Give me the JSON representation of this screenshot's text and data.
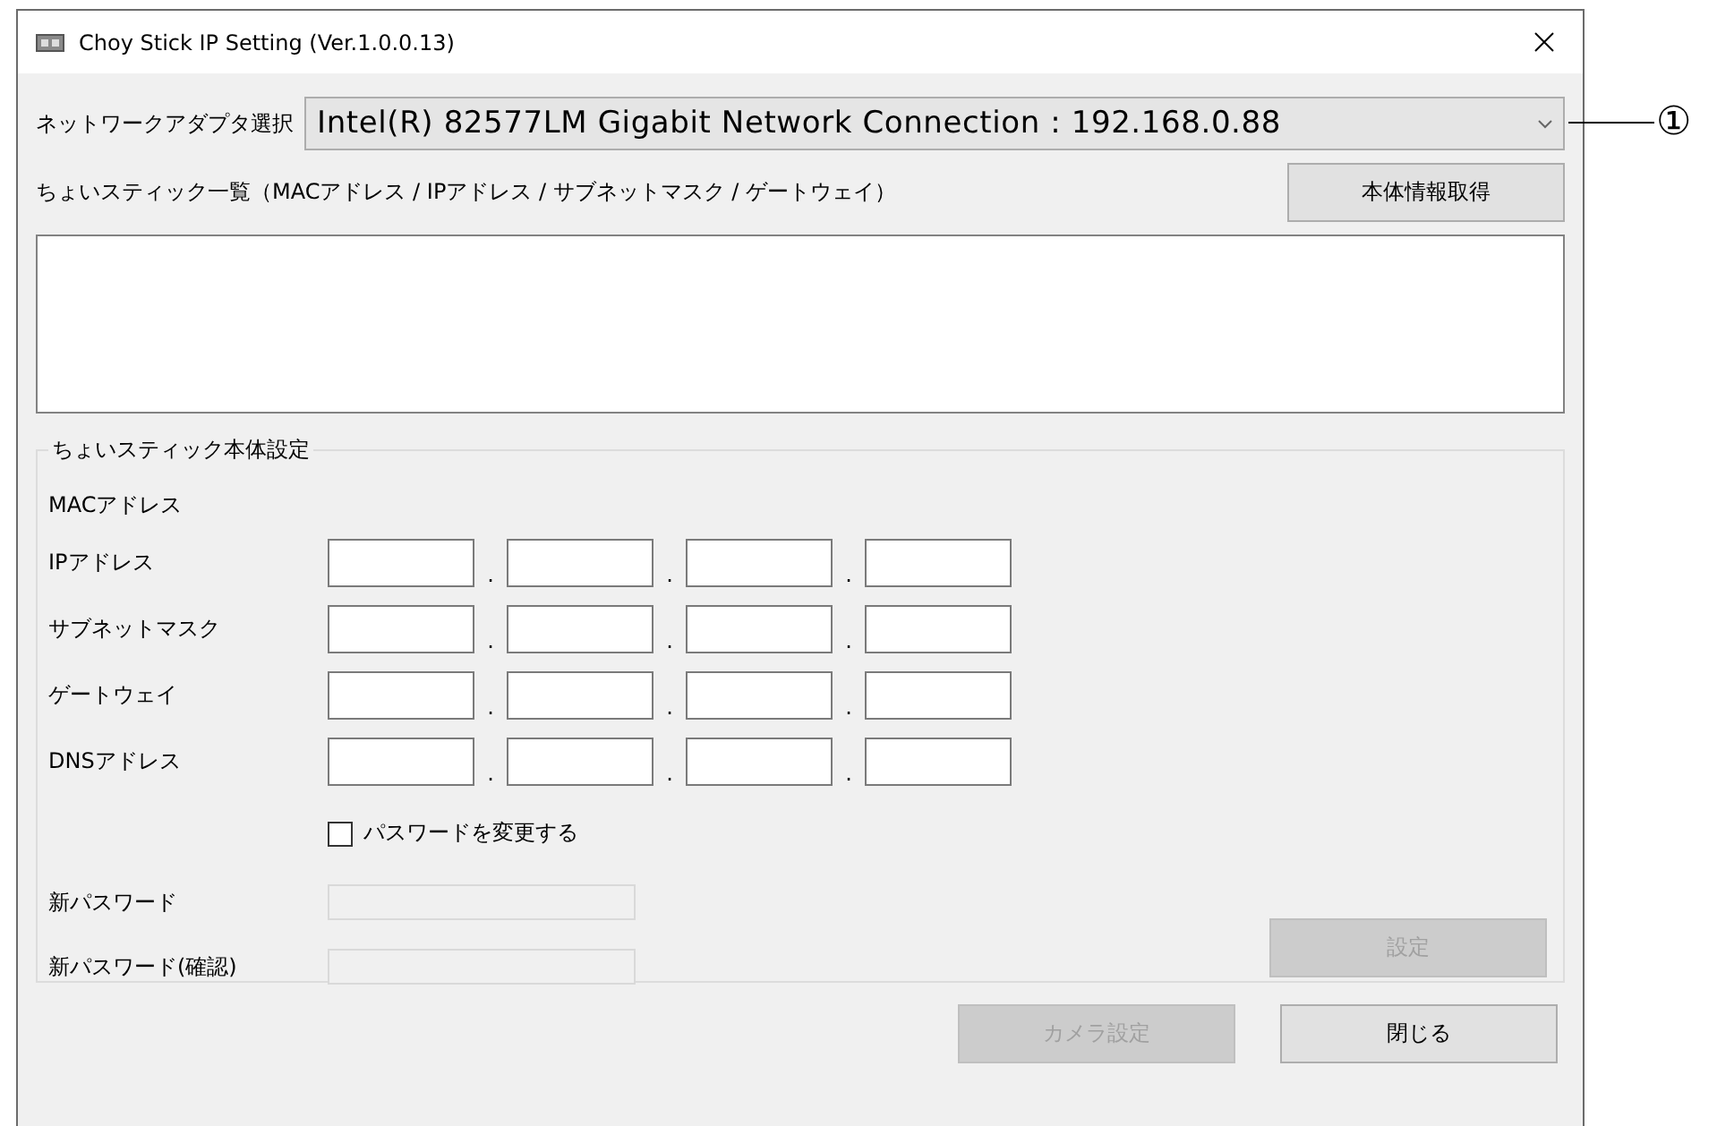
{
  "window": {
    "title": "Choy Stick IP Setting (Ver.1.0.0.13)"
  },
  "adapter": {
    "label": "ネットワークアダプタ選択",
    "value": "Intel(R) 82577LM Gigabit Network Connection : 192.168.0.88"
  },
  "callout": "①",
  "list": {
    "label": "ちょいスティック一覧（MACアドレス / IPアドレス / サブネットマスク / ゲートウェイ）",
    "button": "本体情報取得"
  },
  "settings": {
    "title": "ちょいスティック本体設定",
    "mac_label": "MACアドレス",
    "address_rows": [
      {
        "label": "IPアドレス",
        "separators": [
          ".",
          ".",
          "."
        ]
      },
      {
        "label": "サブネットマスク",
        "separators": [
          ".",
          ".",
          "."
        ]
      },
      {
        "label": "ゲートウェイ",
        "separators": [
          ".",
          ".",
          "."
        ]
      },
      {
        "label": "DNSアドレス",
        "separators": [
          ".",
          ".",
          "."
        ]
      }
    ],
    "change_password": {
      "label": "パスワードを変更する",
      "checked": false
    },
    "password_fields": [
      {
        "label": "新パスワード",
        "disabled": true
      },
      {
        "label": "新パスワード(確認)",
        "disabled": true
      }
    ],
    "apply_button": {
      "label": "設定",
      "disabled": true
    }
  },
  "buttons": [
    {
      "label": "カメラ設定",
      "disabled": true
    },
    {
      "label": "閉じる",
      "disabled": false
    }
  ]
}
